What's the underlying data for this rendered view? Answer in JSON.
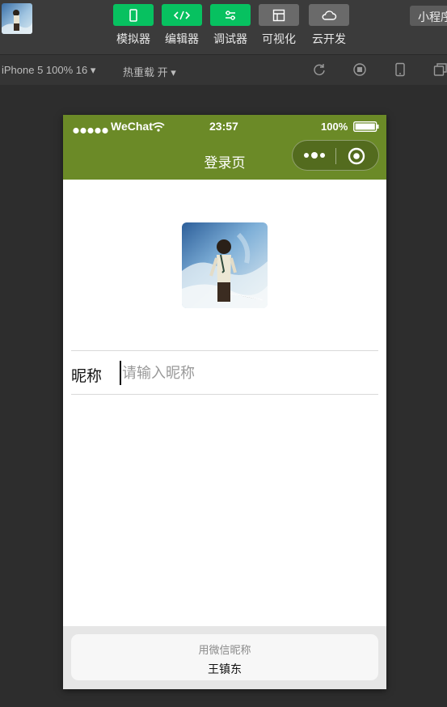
{
  "toolbar": {
    "tools": [
      {
        "label": "模拟器",
        "icon": "phone-icon",
        "active": true
      },
      {
        "label": "编辑器",
        "icon": "code-icon",
        "active": true
      },
      {
        "label": "调试器",
        "icon": "sliders-icon",
        "active": true
      },
      {
        "label": "可视化",
        "icon": "layout-icon",
        "active": false
      },
      {
        "label": "云开发",
        "icon": "cloud-icon",
        "active": false
      }
    ],
    "mini_program_label": "小程序"
  },
  "subbar": {
    "device": "iPhone 5 100% 16 ▾",
    "hot_reload": "热重载 开 ▾"
  },
  "phone": {
    "status": {
      "carrier": "WeChat",
      "time": "23:57",
      "battery": "100%"
    },
    "nav_title": "登录页",
    "nickname_label": "昵称",
    "nickname_placeholder": "请输入昵称",
    "nickname_value": ""
  },
  "suggestion": {
    "title": "用微信昵称",
    "name": "王镇东"
  },
  "colors": {
    "nav_bg": "#6b8a27",
    "tool_active": "#07c160",
    "tool_inactive": "#6a6a6a",
    "ide_bg": "#2d2d2d"
  }
}
